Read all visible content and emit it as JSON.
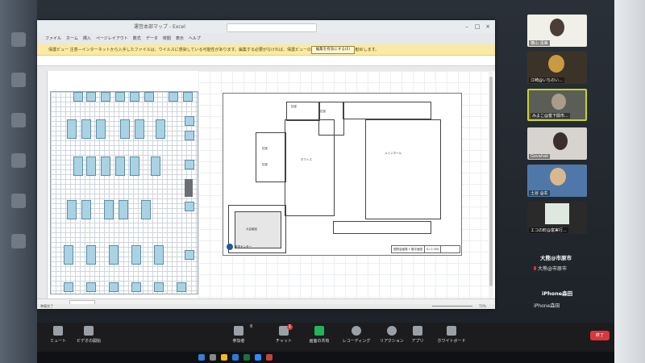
{
  "excel": {
    "title": "運営本部マップ - Excel",
    "menu": [
      "ファイル",
      "ホーム",
      "挿入",
      "ページレイアウト",
      "数式",
      "データ",
      "校閲",
      "表示",
      "ヘルプ"
    ],
    "protected_view_message": "保護ビュー 注意—インターネットから入手したファイルは、ウイルスに感染している可能性があります。編集する必要がなければ、保護ビューのままにしておくことをお勧めします。",
    "enable_editing_label": "編集を有効にする(E)",
    "status_left": "準備完了",
    "zoom": "72%",
    "floorplan": {
      "logo_text": "都市センター",
      "caption": [
        "国際会議場 1 階平面図",
        "S=1:300"
      ],
      "rooms": [
        "控室",
        "控室",
        "ホワイエ",
        "メインホール",
        "控室",
        "控室",
        "大会議室"
      ]
    }
  },
  "participants": [
    {
      "name": "横山 清美",
      "color": "#6a5a50"
    },
    {
      "name": "江崎@いちのい...",
      "color": "#c99a44"
    },
    {
      "name": "みよこ@富下関市...",
      "color": "#8a8f82"
    },
    {
      "name": "Govahak",
      "color": "#b7a89c"
    },
    {
      "name": "土谷 @玄",
      "color": "#4f78a8"
    },
    {
      "name": "エコの町@富実行...",
      "color": "#dfe8df"
    }
  ],
  "name_only": [
    {
      "name": "大熊@市原市",
      "bold": true
    },
    {
      "name": "大熊@市原市",
      "bold": false,
      "muted": true
    },
    {
      "name": "iPhone森田",
      "bold": true
    },
    {
      "name": "iPhone森田",
      "bold": false
    }
  ],
  "controls": [
    {
      "label": "ミュート",
      "icon": "microphone-icon"
    },
    {
      "label": "ビデオの開始",
      "icon": "video-icon"
    },
    {
      "label": "参加者",
      "icon": "participants-icon",
      "count": "8"
    },
    {
      "label": "チャット",
      "icon": "chat-icon",
      "badge": "1"
    },
    {
      "label": "画面の共有",
      "icon": "share-screen-icon"
    },
    {
      "label": "レコーディング",
      "icon": "record-icon"
    },
    {
      "label": "リアクション",
      "icon": "reaction-icon"
    },
    {
      "label": "アプリ",
      "icon": "apps-icon"
    },
    {
      "label": "ホワイトボード",
      "icon": "whiteboard-icon"
    }
  ],
  "end_label": "終了",
  "accent": {
    "share": "#23b35a",
    "end": "#d9363e",
    "protected_bar": "#fbeaa3"
  }
}
